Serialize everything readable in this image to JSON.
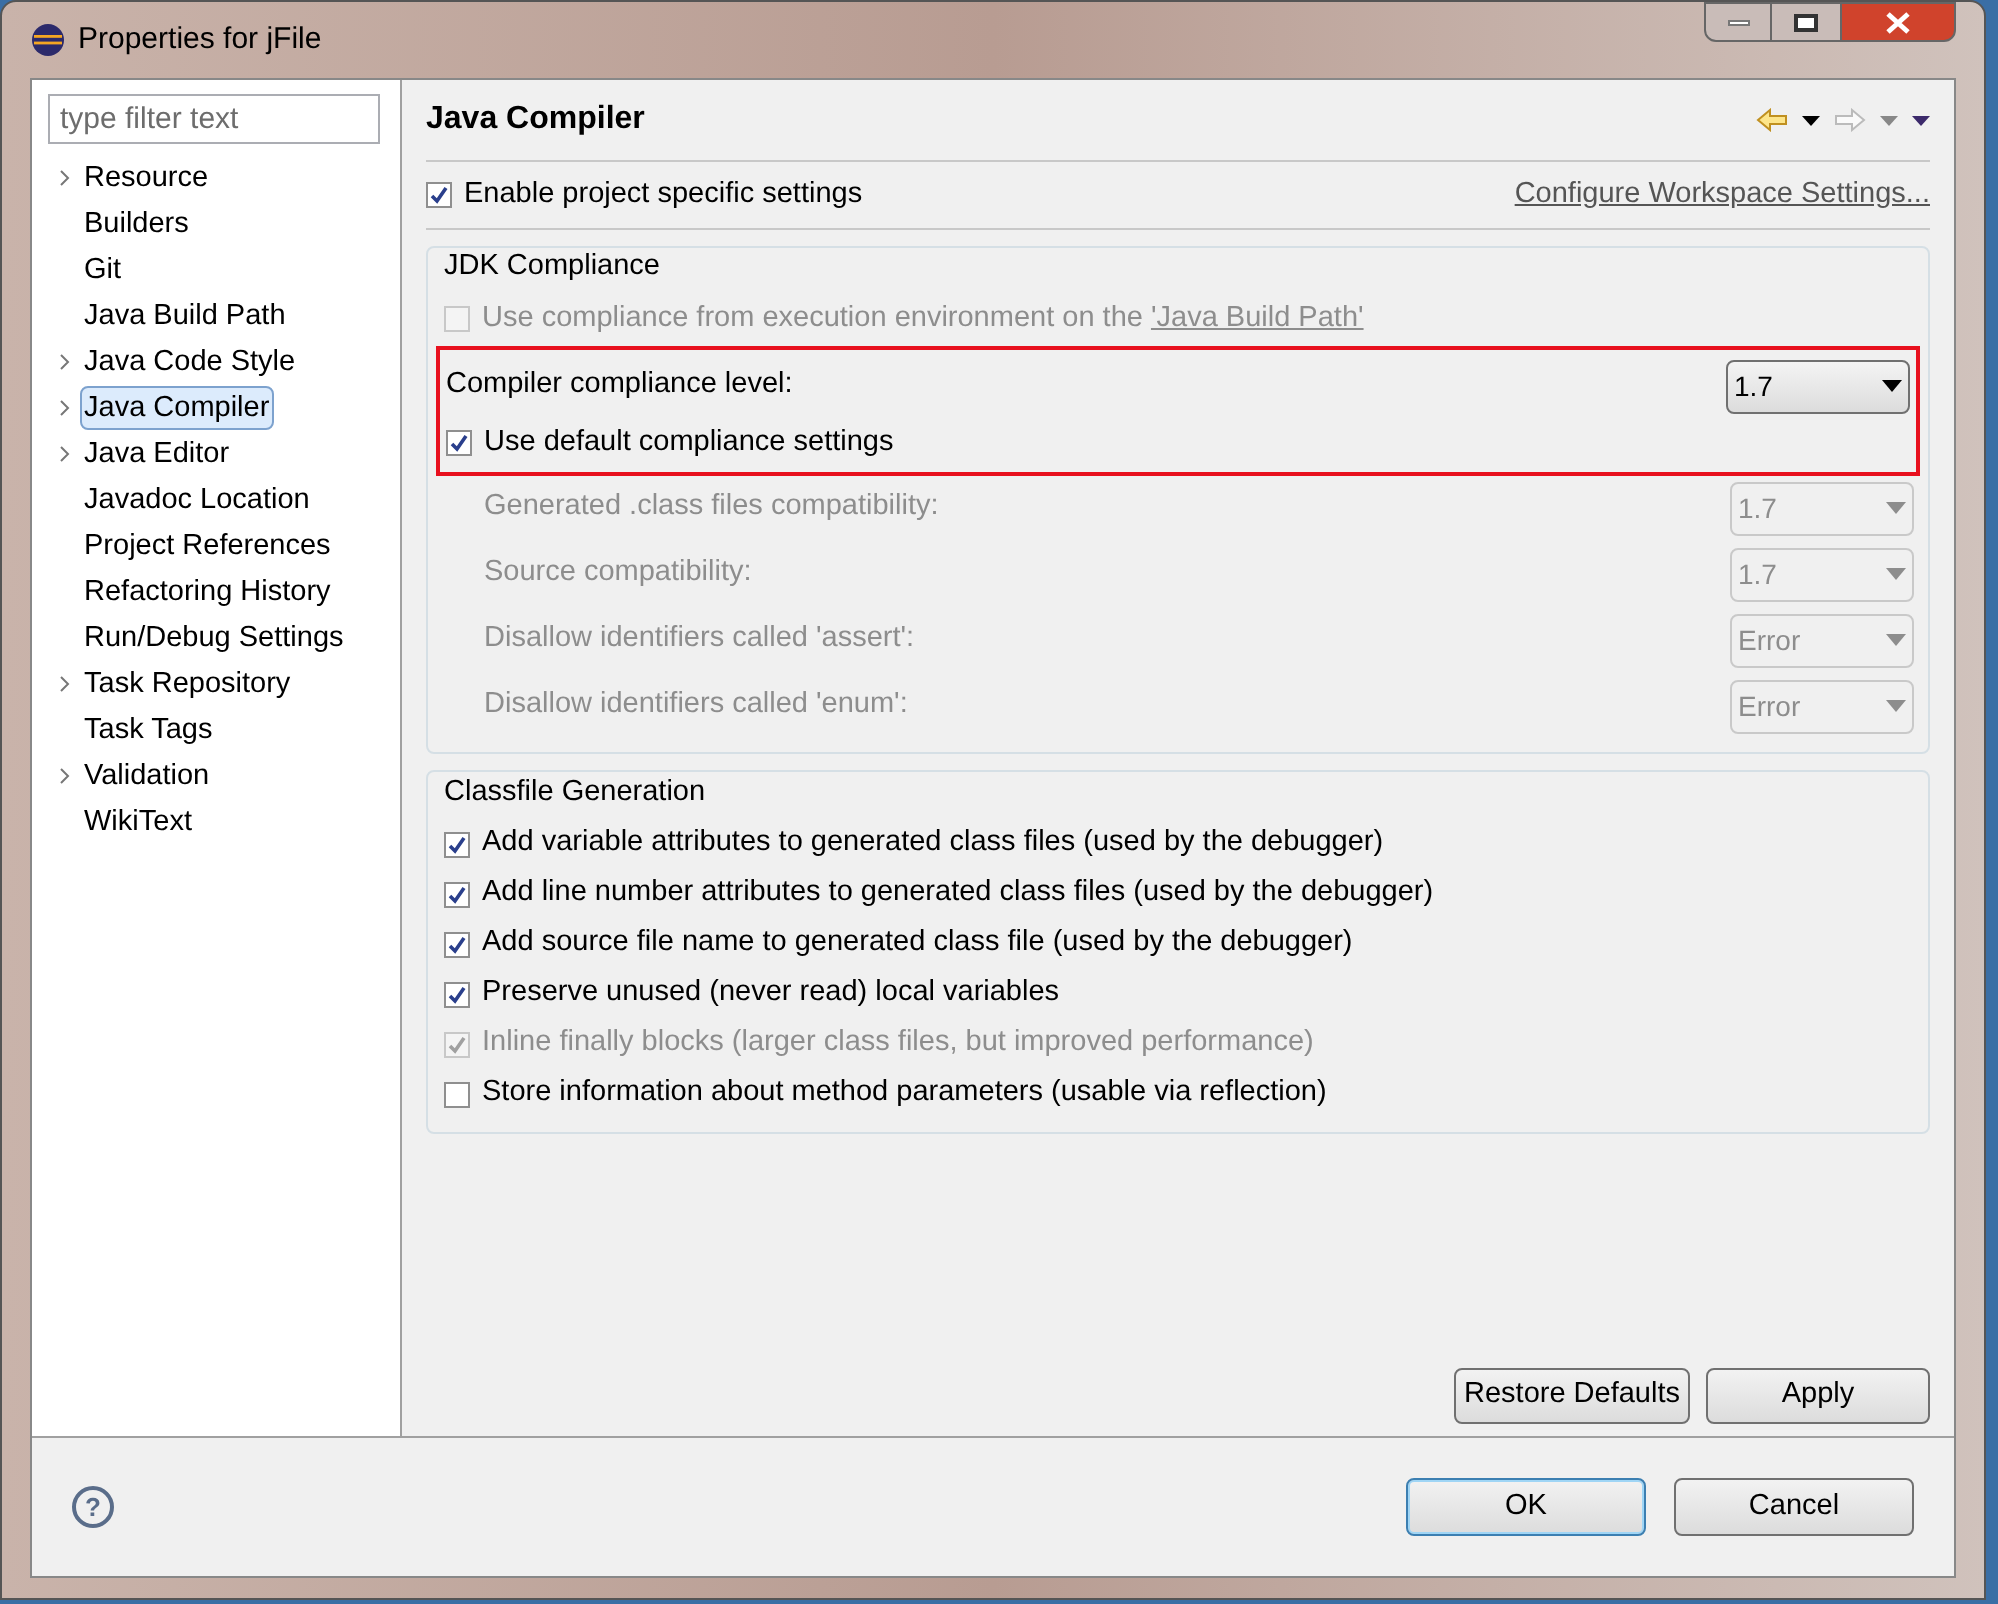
{
  "window": {
    "title": "Properties for jFile"
  },
  "filter": {
    "placeholder": "type filter text"
  },
  "tree": [
    {
      "label": "Resource",
      "expandable": true,
      "selected": false
    },
    {
      "label": "Builders",
      "expandable": false,
      "selected": false
    },
    {
      "label": "Git",
      "expandable": false,
      "selected": false
    },
    {
      "label": "Java Build Path",
      "expandable": false,
      "selected": false
    },
    {
      "label": "Java Code Style",
      "expandable": true,
      "selected": false
    },
    {
      "label": "Java Compiler",
      "expandable": true,
      "selected": true
    },
    {
      "label": "Java Editor",
      "expandable": true,
      "selected": false
    },
    {
      "label": "Javadoc Location",
      "expandable": false,
      "selected": false
    },
    {
      "label": "Project References",
      "expandable": false,
      "selected": false
    },
    {
      "label": "Refactoring History",
      "expandable": false,
      "selected": false
    },
    {
      "label": "Run/Debug Settings",
      "expandable": false,
      "selected": false
    },
    {
      "label": "Task Repository",
      "expandable": true,
      "selected": false
    },
    {
      "label": "Task Tags",
      "expandable": false,
      "selected": false
    },
    {
      "label": "Validation",
      "expandable": true,
      "selected": false
    },
    {
      "label": "WikiText",
      "expandable": false,
      "selected": false
    }
  ],
  "page": {
    "title": "Java Compiler",
    "enable": {
      "label": "Enable project specific settings",
      "checked": true
    },
    "configure_link": "Configure Workspace Settings...",
    "jdk_group": {
      "title": "JDK Compliance",
      "use_ee": {
        "label": "Use compliance from execution environment on the ",
        "link": "'Java Build Path'",
        "checked": false,
        "disabled": true
      },
      "highlight": {
        "marked": true,
        "level_label": "Compiler compliance level:",
        "level_value": "1.7",
        "default_checkbox": {
          "label": "Use default compliance settings",
          "checked": true
        }
      },
      "settings": [
        {
          "label": "Generated .class files compatibility:",
          "value": "1.7",
          "disabled": true
        },
        {
          "label": "Source compatibility:",
          "value": "1.7",
          "disabled": true
        },
        {
          "label": "Disallow identifiers called 'assert':",
          "value": "Error",
          "disabled": true
        },
        {
          "label": "Disallow identifiers called 'enum':",
          "value": "Error",
          "disabled": true
        }
      ]
    },
    "classfile_group": {
      "title": "Classfile Generation",
      "options": [
        {
          "label": "Add variable attributes to generated class files (used by the debugger)",
          "checked": true,
          "disabled": false
        },
        {
          "label": "Add line number attributes to generated class files (used by the debugger)",
          "checked": true,
          "disabled": false
        },
        {
          "label": "Add source file name to generated class file (used by the debugger)",
          "checked": true,
          "disabled": false
        },
        {
          "label": "Preserve unused (never read) local variables",
          "checked": true,
          "disabled": false
        },
        {
          "label": "Inline finally blocks (larger class files, but improved performance)",
          "checked": true,
          "disabled": true
        },
        {
          "label": "Store information about method parameters (usable via reflection)",
          "checked": false,
          "disabled": false
        }
      ]
    },
    "page_buttons": [
      "Restore Defaults",
      "Apply"
    ]
  },
  "help": "?",
  "dialog_buttons": [
    {
      "label": "OK",
      "default": true
    },
    {
      "label": "Cancel",
      "default": false
    }
  ]
}
